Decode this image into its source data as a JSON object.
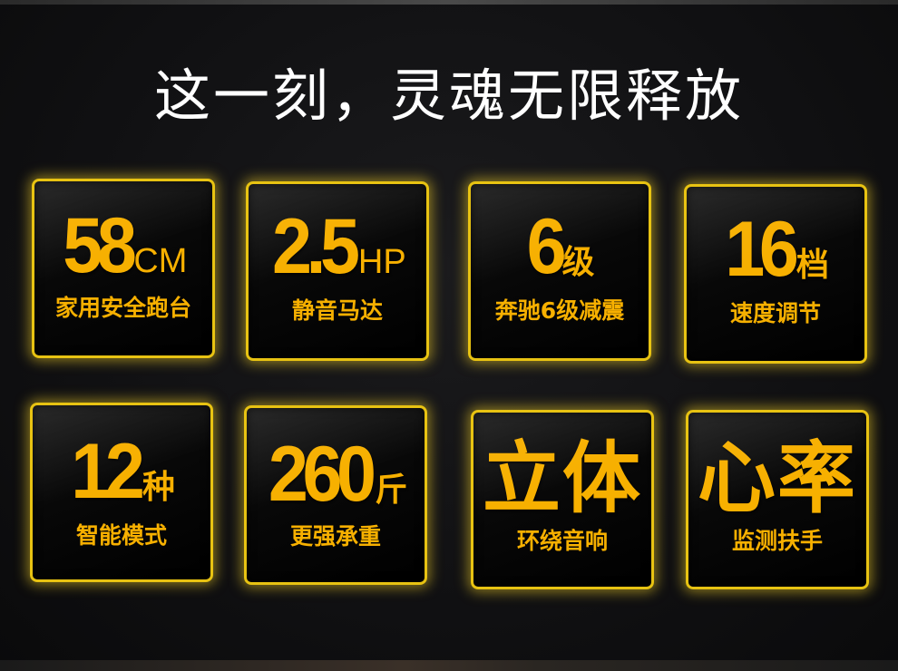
{
  "headline": "这一刻，灵魂无限释放",
  "features": [
    {
      "value": "58",
      "unit": "CM",
      "caption": "家用安全跑台"
    },
    {
      "value": "2.5",
      "unit": "HP",
      "caption": "静音马达"
    },
    {
      "value": "6",
      "unit": "级",
      "caption": "奔驰6级减震"
    },
    {
      "value": "16",
      "unit": "档",
      "caption": "速度调节"
    },
    {
      "value": "12",
      "unit": "种",
      "caption": "智能模式"
    },
    {
      "value": "260",
      "unit": "斤",
      "caption": "更强承重"
    },
    {
      "value": "立体",
      "unit": "",
      "caption": "环绕音响"
    },
    {
      "value": "心率",
      "unit": "",
      "caption": "监测扶手"
    }
  ],
  "colors": {
    "accent": "#f7b000",
    "border": "#e8c312",
    "background": "#101012",
    "headline": "#ffffff"
  }
}
